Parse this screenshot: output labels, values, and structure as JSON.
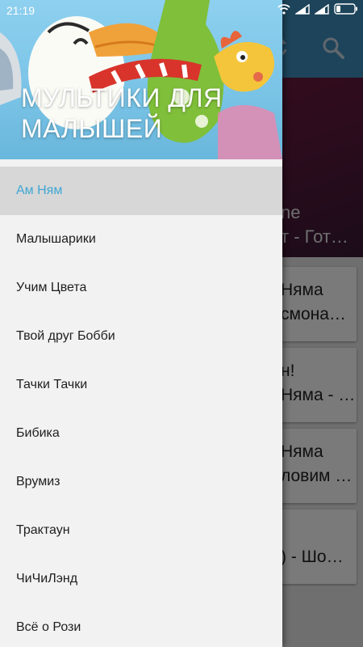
{
  "status_bar": {
    "time": "21:19"
  },
  "drawer": {
    "title": "МУЛЬТИКИ ДЛЯ МАЛЫШЕЙ",
    "active_color": "#3fa7d3",
    "items": [
      {
        "label": "Ам Ням",
        "active": true
      },
      {
        "label": "Малышарики"
      },
      {
        "label": "Учим Цвета"
      },
      {
        "label": "Твой друг Бобби"
      },
      {
        "label": "Тачки Тачки"
      },
      {
        "label": "Бибика"
      },
      {
        "label": "Врумиз"
      },
      {
        "label": "Трактаун"
      },
      {
        "label": "ЧиЧиЛэнд"
      },
      {
        "label": "Всё о Рози"
      }
    ]
  },
  "background": {
    "toolbar_color": "#3d8fbd",
    "hero_text": "ne\nт - Гот…",
    "cards": [
      {
        "text": "Няма\nсмона…"
      },
      {
        "text": "н!\nНяма - …"
      },
      {
        "text": "Няма\nловим …"
      },
      {
        "text": "\n) - Шо…"
      }
    ]
  }
}
